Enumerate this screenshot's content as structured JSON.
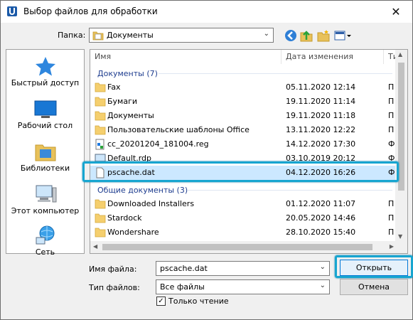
{
  "window": {
    "title": "Выбор файлов для обработки",
    "close_glyph": "✕"
  },
  "folder": {
    "label": "Папка:",
    "value": "Документы"
  },
  "places": [
    {
      "label": "Быстрый доступ",
      "icon": "star-icon"
    },
    {
      "label": "Рабочий стол",
      "icon": "desktop-icon"
    },
    {
      "label": "Библиотеки",
      "icon": "libraries-icon"
    },
    {
      "label": "Этот компьютер",
      "icon": "computer-icon"
    },
    {
      "label": "Сеть",
      "icon": "network-icon"
    }
  ],
  "columns": {
    "name": "Имя",
    "date": "Дата изменения",
    "type": "Ти"
  },
  "groups": [
    {
      "label": "Документы (7)"
    },
    {
      "label": "Общие документы (3)"
    }
  ],
  "files": [
    {
      "name": "Fax",
      "date": "05.11.2020 12:14",
      "type": "П",
      "icon": "folder-icon"
    },
    {
      "name": "Бумаги",
      "date": "19.11.2020 11:14",
      "type": "П",
      "icon": "folder-icon"
    },
    {
      "name": "Документы",
      "date": "19.11.2020 11:18",
      "type": "П",
      "icon": "folder-icon"
    },
    {
      "name": "Пользовательские шаблоны Office",
      "date": "13.11.2020 12:22",
      "type": "П",
      "icon": "folder-icon"
    },
    {
      "name": "cc_20201204_181004.reg",
      "date": "14.12.2020 17:30",
      "type": "Ф",
      "icon": "registry-file-icon"
    },
    {
      "name": "Default.rdp",
      "date": "03.10.2019 20:12",
      "type": "Ф",
      "icon": "rdp-file-icon"
    },
    {
      "name": "pscache.dat",
      "date": "04.12.2020 16:26",
      "type": "Ф",
      "icon": "file-icon",
      "selected": true
    }
  ],
  "shared_files": [
    {
      "name": "Downloaded Installers",
      "date": "01.12.2020 11:07",
      "type": "П",
      "icon": "folder-icon"
    },
    {
      "name": "Stardock",
      "date": "20.05.2020 14:46",
      "type": "П",
      "icon": "folder-icon"
    },
    {
      "name": "Wondershare",
      "date": "28.10.2020 15:40",
      "type": "П",
      "icon": "folder-icon"
    }
  ],
  "filename": {
    "label": "Имя файла:",
    "value": "pscache.dat"
  },
  "filetype": {
    "label": "Тип файлов:",
    "value": "Все файлы"
  },
  "readonly": {
    "label": "Только чтение",
    "checked": true,
    "glyph": "✓"
  },
  "buttons": {
    "open": "Открыть",
    "cancel": "Отмена"
  },
  "colors": {
    "highlight": "#17a5d0",
    "selection": "#cce8ff",
    "group_text": "#1e3d8f"
  }
}
